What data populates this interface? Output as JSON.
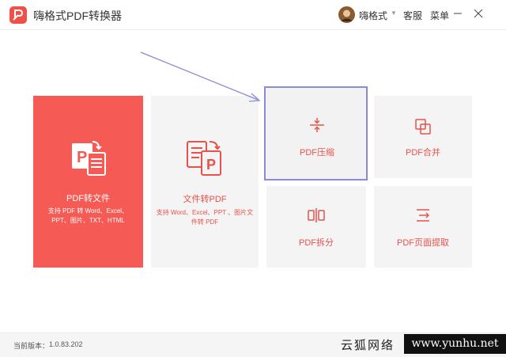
{
  "app": {
    "title": "嗨格式PDF转换器"
  },
  "header": {
    "username": "嗨格式",
    "caret": "▼",
    "service_label": "客服",
    "menu_label": "菜单"
  },
  "cards": [
    {
      "id": "pdf-to-file",
      "label": "PDF转文件",
      "desc": "支持 PDF 转 Word、Excel、PPT、图片、TXT、HTML",
      "icon": "pdf-convert-icon"
    },
    {
      "id": "file-to-pdf",
      "label": "文件转PDF",
      "desc": "支持 Word、Excel、PPT 、图片文件转 PDF",
      "icon": "file-to-pdf-icon"
    },
    {
      "id": "pdf-compress",
      "label": "PDF压缩",
      "icon": "compress-icon"
    },
    {
      "id": "pdf-merge",
      "label": "PDF合并",
      "icon": "merge-icon"
    },
    {
      "id": "pdf-split",
      "label": "PDF拆分",
      "icon": "split-icon"
    },
    {
      "id": "pdf-extract",
      "label": "PDF页面提取",
      "icon": "extract-icon"
    }
  ],
  "footer": {
    "version_label": "当前版本：",
    "version": "1.0.83.202"
  },
  "watermark": {
    "text": "云狐网络",
    "url": "www.yunhu.net"
  },
  "colors": {
    "accent": "#f55a54",
    "icon": "#e8524a",
    "highlight": "#8a8ad8",
    "card_bg": "#f4f4f4"
  }
}
